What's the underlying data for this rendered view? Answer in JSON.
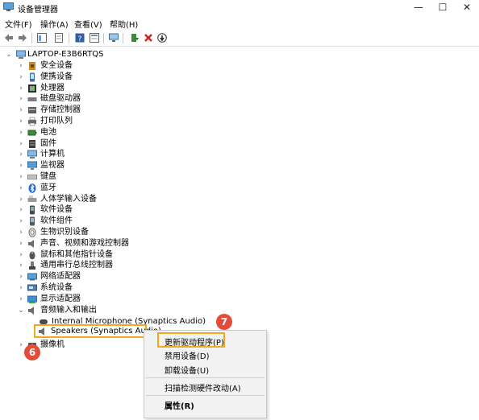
{
  "window": {
    "title": "设备管理器",
    "buttons": {
      "minimize": "—",
      "maximize": "☐",
      "close": "✕"
    }
  },
  "menu": [
    "文件(F)",
    "操作(A)",
    "查看(V)",
    "帮助(H)"
  ],
  "tree": {
    "root": "LAPTOP-E3B6RTQS",
    "categories": [
      {
        "label": "安全设备",
        "icon": "security-device-icon"
      },
      {
        "label": "便携设备",
        "icon": "portable-device-icon"
      },
      {
        "label": "处理器",
        "icon": "processor-icon"
      },
      {
        "label": "磁盘驱动器",
        "icon": "disk-drive-icon"
      },
      {
        "label": "存储控制器",
        "icon": "storage-controller-icon"
      },
      {
        "label": "打印队列",
        "icon": "printer-icon"
      },
      {
        "label": "电池",
        "icon": "battery-icon"
      },
      {
        "label": "固件",
        "icon": "firmware-icon"
      },
      {
        "label": "计算机",
        "icon": "computer-icon"
      },
      {
        "label": "监视器",
        "icon": "monitor-icon"
      },
      {
        "label": "键盘",
        "icon": "keyboard-icon"
      },
      {
        "label": "蓝牙",
        "icon": "bluetooth-icon"
      },
      {
        "label": "人体学输入设备",
        "icon": "hid-icon"
      },
      {
        "label": "软件设备",
        "icon": "software-device-icon"
      },
      {
        "label": "软件组件",
        "icon": "software-component-icon"
      },
      {
        "label": "生物识别设备",
        "icon": "biometric-icon"
      },
      {
        "label": "声音、视频和游戏控制器",
        "icon": "sound-icon"
      },
      {
        "label": "鼠标和其他指针设备",
        "icon": "mouse-icon"
      },
      {
        "label": "通用串行总线控制器",
        "icon": "usb-icon"
      },
      {
        "label": "网络适配器",
        "icon": "network-adapter-icon"
      },
      {
        "label": "系统设备",
        "icon": "system-device-icon"
      },
      {
        "label": "显示适配器",
        "icon": "display-adapter-icon"
      }
    ],
    "audio": {
      "label": "音频输入和输出",
      "children": [
        "Internal Microphone (Synaptics Audio)",
        "Speakers (Synaptics Audio)"
      ]
    },
    "partial": "摄像机"
  },
  "context_menu": {
    "update": "更新驱动程序(P)",
    "disable": "禁用设备(D)",
    "uninstall": "卸载设备(U)",
    "scan": "扫描检测硬件改动(A)",
    "properties": "属性(R)"
  },
  "badges": {
    "step6": "6",
    "step7": "7"
  },
  "colors": {
    "highlight": "#f2a91e",
    "badge": "#e34b3a"
  }
}
